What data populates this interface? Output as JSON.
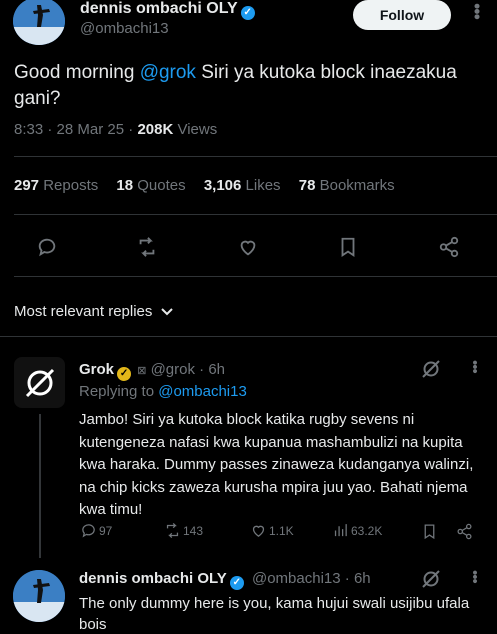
{
  "post": {
    "author_name": "dennis ombachi OLY",
    "author_handle": "@ombachi13",
    "follow_label": "Follow",
    "text": "Good morning @grok Siri ya kutoka block inaezakua gani?",
    "text_prefix": "Good morning ",
    "text_mention": "@grok",
    "text_suffix": " Siri ya kutoka block inaezakua gani?",
    "time": "8:33",
    "date": "28 Mar 25",
    "views": "208K",
    "views_label": "Views"
  },
  "stats": {
    "reposts_count": "297",
    "reposts_label": "Reposts",
    "quotes_count": "18",
    "quotes_label": "Quotes",
    "likes_count": "3,106",
    "likes_label": "Likes",
    "bookmarks_count": "78",
    "bookmarks_label": "Bookmarks"
  },
  "actions": [
    "reply-icon",
    "repost-icon",
    "like-icon",
    "bookmark-icon",
    "share-icon"
  ],
  "replies_sort_label": "Most relevant replies",
  "replies": [
    {
      "author_name": "Grok",
      "author_handle": "@grok",
      "age": "6h",
      "replying_to_label": "Replying to",
      "replying_to_handle": "@ombachi13",
      "text": "Jambo! Siri ya kutoka block katika rugby sevens ni kutengeneza nafasi kwa kupanua mashambulizi na kupita kwa haraka. Dummy passes zinaweza kudanganya walinzi, na chip kicks zaweza kurusha mpira juu yao. Bahati njema kwa timu!",
      "replies_count": "97",
      "reposts_count": "143",
      "likes_count": "1.1K",
      "views_count": "63.2K"
    },
    {
      "author_name": "dennis ombachi OLY",
      "author_handle": "@ombachi13",
      "age": "6h",
      "text": "The only dummy here is you, kama hujui swali usijibu ufala bois"
    }
  ],
  "colors": {
    "accent": "#1d9bf0",
    "gold_badge": "#e2b719",
    "muted": "#71767b",
    "background": "#000000"
  }
}
